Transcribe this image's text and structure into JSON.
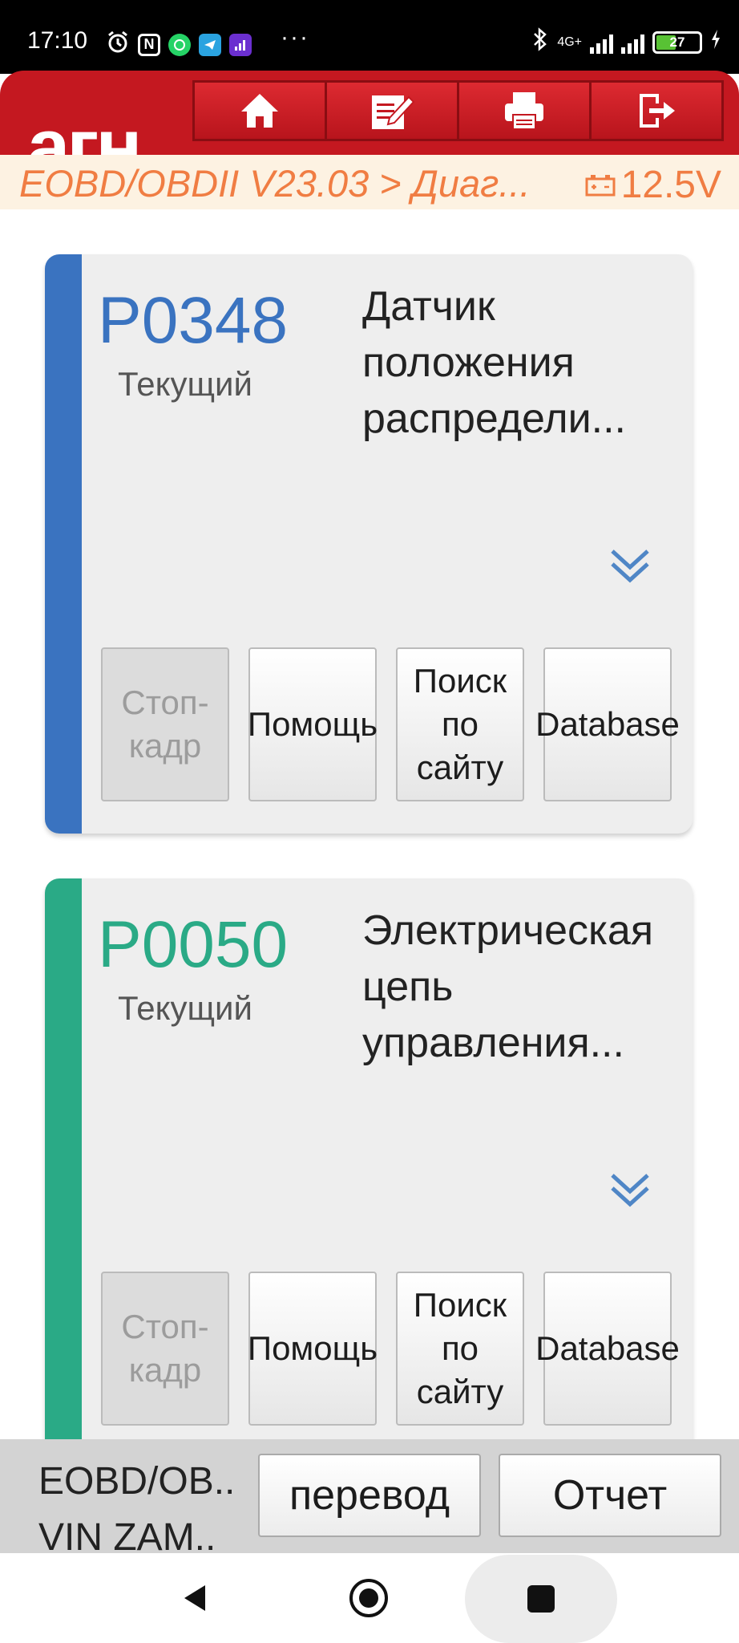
{
  "status_bar": {
    "time": "17:10",
    "network": "4G+",
    "battery": "27",
    "icons": [
      "alarm-icon",
      "nfc-icon",
      "whatsapp-icon",
      "telegram-icon",
      "signal-app-icon",
      "more-icon"
    ]
  },
  "header": {
    "logo": "агн",
    "toolbar": [
      "home-icon",
      "edit-icon",
      "print-icon",
      "exit-icon"
    ]
  },
  "breadcrumb": {
    "path": "EOBD/OBDII V23.03 > Диаг...",
    "voltage": "12.5V"
  },
  "dtc_cards": [
    {
      "code": "P0348",
      "status": "Текущий",
      "description": "Датчик положения распредели...",
      "accent_color": "#3a73c0",
      "buttons": [
        "Стоп-кадр",
        "Помощь",
        "Поиск по сайту",
        "Database"
      ]
    },
    {
      "code": "P0050",
      "status": "Текущий",
      "description": "Электрическая цепь управления...",
      "accent_color": "#2aaa86",
      "buttons": [
        "Стоп-кадр",
        "Помощь",
        "Поиск по сайту",
        "Database"
      ]
    }
  ],
  "bottom_bar": {
    "line1": "EOBD/OB..",
    "line2": "VIN ZAM..",
    "translate_label": "перевод",
    "report_label": "Отчет"
  },
  "nav": [
    "back-icon",
    "home-circle-icon",
    "recents-icon"
  ]
}
